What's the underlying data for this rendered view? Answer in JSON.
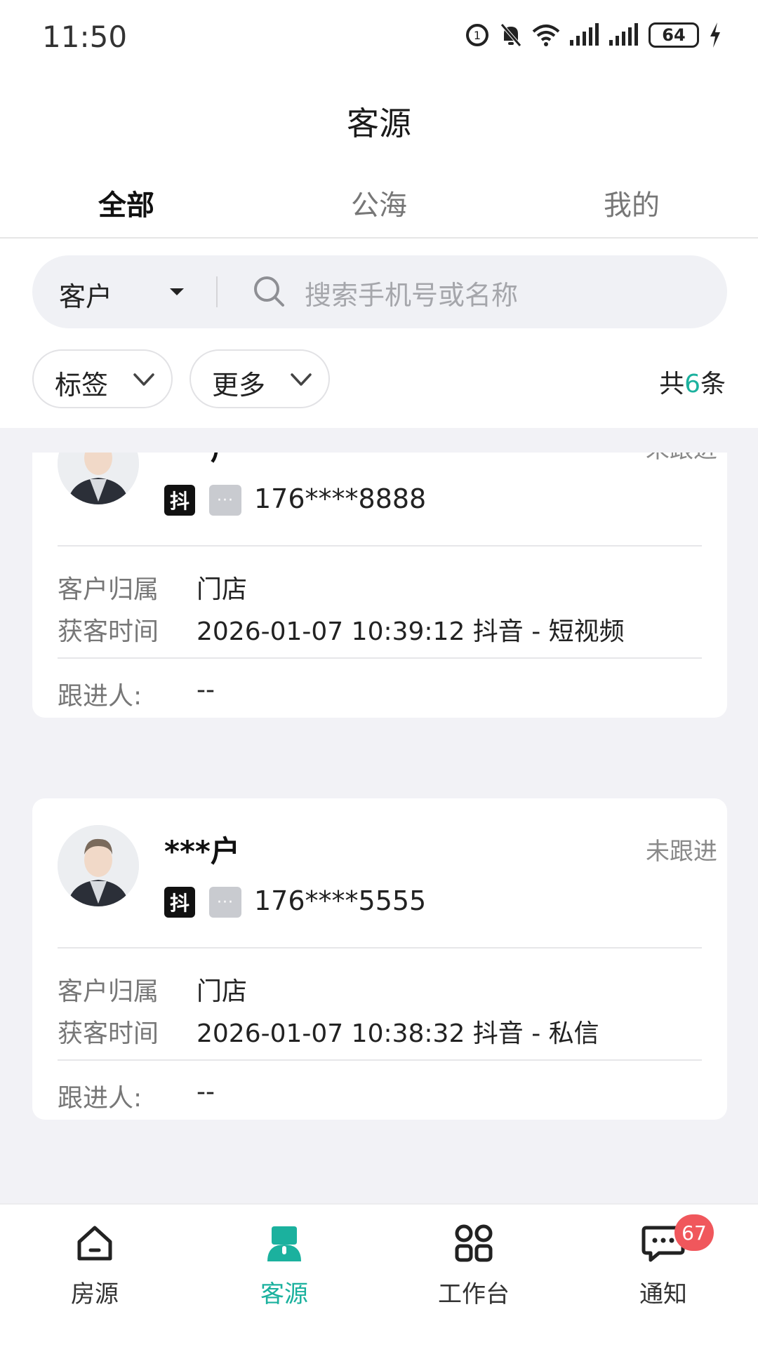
{
  "status_bar": {
    "time": "11:50",
    "battery": "64",
    "icons": [
      "hd-voice-icon",
      "mute-icon",
      "wifi-icon",
      "signal-icon",
      "signal-icon",
      "battery-icon",
      "charging-icon"
    ]
  },
  "header": {
    "title": "客源"
  },
  "tabs": [
    {
      "label": "全部",
      "active": true
    },
    {
      "label": "公海",
      "active": false
    },
    {
      "label": "我的",
      "active": false
    }
  ],
  "search": {
    "type": "客户",
    "placeholder": "搜索手机号或名称"
  },
  "filters": [
    {
      "label": "标签"
    },
    {
      "label": "更多"
    }
  ],
  "count": {
    "prefix": "共",
    "value": "6",
    "suffix": "条"
  },
  "customers": [
    {
      "name": "***户",
      "status": "未跟进",
      "source_badge": "抖",
      "more_badge": "···",
      "phone": "176****8888",
      "owner_label": "客户归属",
      "owner": "门店",
      "time_label": "获客时间",
      "time": "2026-01-07 10:39:12 抖音 - 短视频",
      "follower_label": "跟进人:",
      "follower": "--"
    },
    {
      "name": "***户",
      "status": "未跟进",
      "source_badge": "抖",
      "more_badge": "···",
      "phone": "176****5555",
      "owner_label": "客户归属",
      "owner": "门店",
      "time_label": "获客时间",
      "time": "2026-01-07 10:38:32 抖音 - 私信",
      "follower_label": "跟进人:",
      "follower": "--"
    }
  ],
  "bottom_nav": [
    {
      "label": "房源",
      "icon": "house-icon",
      "active": false
    },
    {
      "label": "客源",
      "icon": "customer-icon",
      "active": true
    },
    {
      "label": "工作台",
      "icon": "grid-icon",
      "active": false
    },
    {
      "label": "通知",
      "icon": "chat-icon",
      "active": false,
      "badge": "67"
    }
  ],
  "colors": {
    "accent": "#1bb19e",
    "badge": "#f0575c",
    "background": "#f2f2f6"
  }
}
